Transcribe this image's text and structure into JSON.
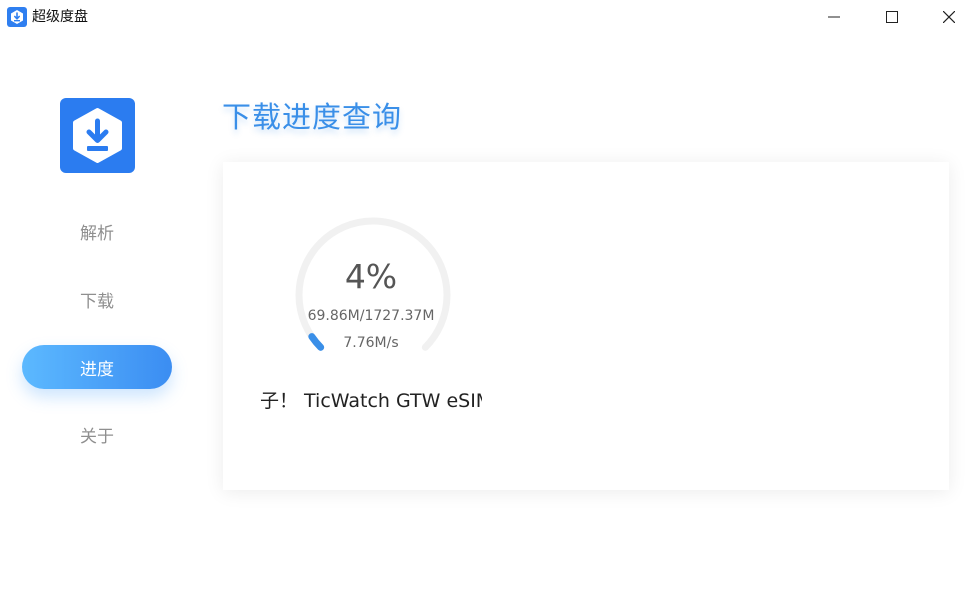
{
  "app": {
    "title": "超级度盘"
  },
  "window_controls": {
    "minimize": "minimize",
    "maximize": "maximize",
    "close": "close"
  },
  "sidebar": {
    "items": [
      {
        "label": "解析",
        "active": false
      },
      {
        "label": "下载",
        "active": false
      },
      {
        "label": "进度",
        "active": true
      },
      {
        "label": "关于",
        "active": false
      }
    ]
  },
  "main": {
    "title": "下载进度查询",
    "progress": {
      "percent_text": "4%",
      "percent": 4,
      "size_text": "69.86M/1727.37M",
      "speed_text": "7.76M/s",
      "file_name": "子！ TicWatch GTW eSIM"
    }
  },
  "colors": {
    "accent": "#3a8fe8",
    "active_gradient_start": "#5cb9ff",
    "active_gradient_end": "#3b8df2",
    "progress_fill": "#3a8fe8",
    "progress_track": "#f1f1f1"
  }
}
